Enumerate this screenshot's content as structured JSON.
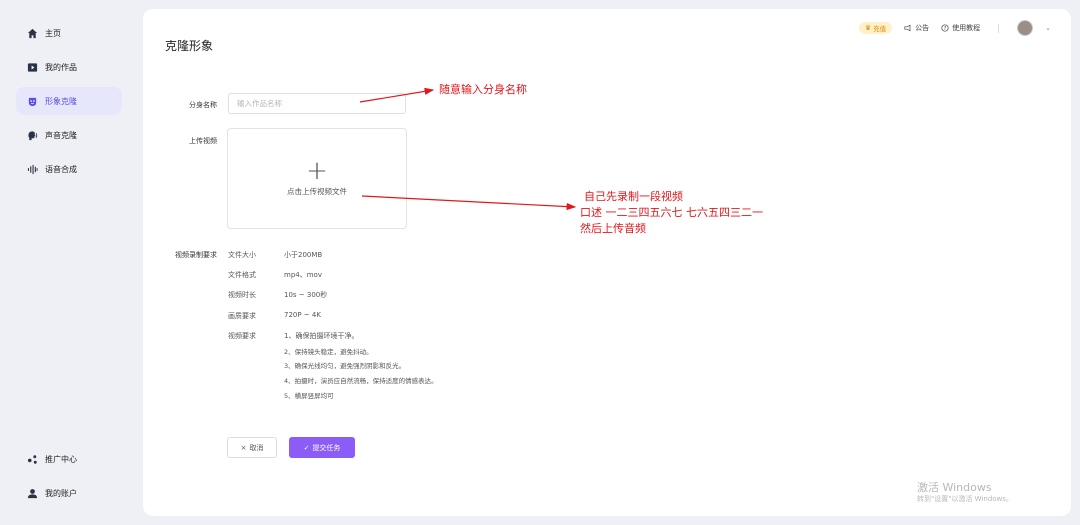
{
  "sidebar": {
    "items": [
      {
        "label": "主页",
        "icon": "home-icon"
      },
      {
        "label": "我的作品",
        "icon": "video-icon"
      },
      {
        "label": "形象克隆",
        "icon": "mask-icon",
        "active": true
      },
      {
        "label": "声音克隆",
        "icon": "speaker-head-icon"
      },
      {
        "label": "语音合成",
        "icon": "soundwave-icon"
      }
    ],
    "bottom_items": [
      {
        "label": "推广中心",
        "icon": "share-icon"
      },
      {
        "label": "我的账户",
        "icon": "user-icon"
      }
    ],
    "accent": "#5b4ee8"
  },
  "header": {
    "badge": "充值",
    "notice": "公告",
    "tutorial": "使用教程"
  },
  "main": {
    "title": "克隆形象",
    "name_label": "分身名称",
    "name_placeholder": "输入作品名称",
    "upload_label": "上传视频",
    "upload_text": "点击上传视频文件",
    "requirements_label": "视频录制要求",
    "requirements": [
      {
        "key": "文件大小",
        "value": "小于200MB"
      },
      {
        "key": "文件格式",
        "value": "mp4、mov"
      },
      {
        "key": "视频时长",
        "value": "10s ~ 300秒"
      },
      {
        "key": "画质要求",
        "value": "720P ~ 4K"
      },
      {
        "key": "视频要求",
        "value": "1、确保拍摄环境干净。"
      }
    ],
    "video_requirements_more": [
      "2、保持镜头稳定，避免抖动。",
      "3、确保光线均匀，避免强烈阴影和反光。",
      "4、拍摄时，演员应自然流畅，保持适度的情感表达。",
      "5、横屏竖屏均可"
    ],
    "cancel_label": "取消",
    "submit_label": "提交任务",
    "submit_color": "#8b5cf6"
  },
  "annotations": {
    "name_tip": "随意输入分身名称",
    "upload_tip_1": "自己先录制一段视频",
    "upload_tip_2": "口述 一二三四五六七 七六五四三二一",
    "upload_tip_3": "然后上传音频",
    "color": "#e4161a"
  },
  "watermark": {
    "line1": "激活 Windows",
    "line2": "转到\"设置\"以激活 Windows。"
  }
}
